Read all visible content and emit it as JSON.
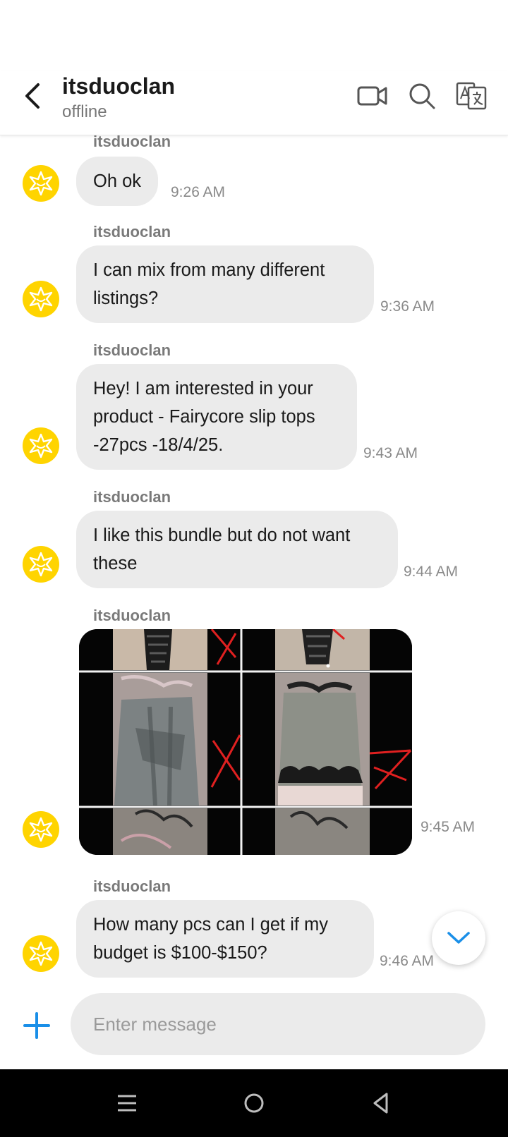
{
  "header": {
    "title": "itsduoclan",
    "status": "offline"
  },
  "messages": [
    {
      "sender": "itsduoclan",
      "lines": [
        "Oh ok"
      ],
      "time": "9:26 AM"
    },
    {
      "sender": "itsduoclan",
      "lines": [
        "I can mix from many different",
        "listings?"
      ],
      "time": "9:36 AM"
    },
    {
      "sender": "itsduoclan",
      "lines": [
        "Hey! I am interested in your",
        "product - Fairycore slip tops",
        "-27pcs -18/4/25."
      ],
      "time": "9:43 AM"
    },
    {
      "sender": "itsduoclan",
      "lines": [
        "I like this bundle but do not want",
        "these"
      ],
      "time": "9:44 AM"
    },
    {
      "sender": "itsduoclan",
      "image": "product-photo-collage",
      "time": "9:45 AM"
    },
    {
      "sender": "itsduoclan",
      "lines": [
        "How many pcs can I get if my",
        "budget is $100-$150?"
      ],
      "time": "9:46 AM"
    }
  ],
  "composer": {
    "placeholder": "Enter message"
  },
  "icons": {
    "back": "chevron-left-icon",
    "video": "video-camera-icon",
    "search": "search-icon",
    "translate": "translate-icon",
    "avatar": "star-burst-avatar-icon",
    "scroll": "chevron-down-icon",
    "add": "plus-icon",
    "nav_menu": "menu-icon",
    "nav_home": "home-circle-icon",
    "nav_back": "back-triangle-icon"
  },
  "colors": {
    "accent": "#1a8fe8",
    "avatar": "#ffd400",
    "bubble": "#ebebeb"
  }
}
